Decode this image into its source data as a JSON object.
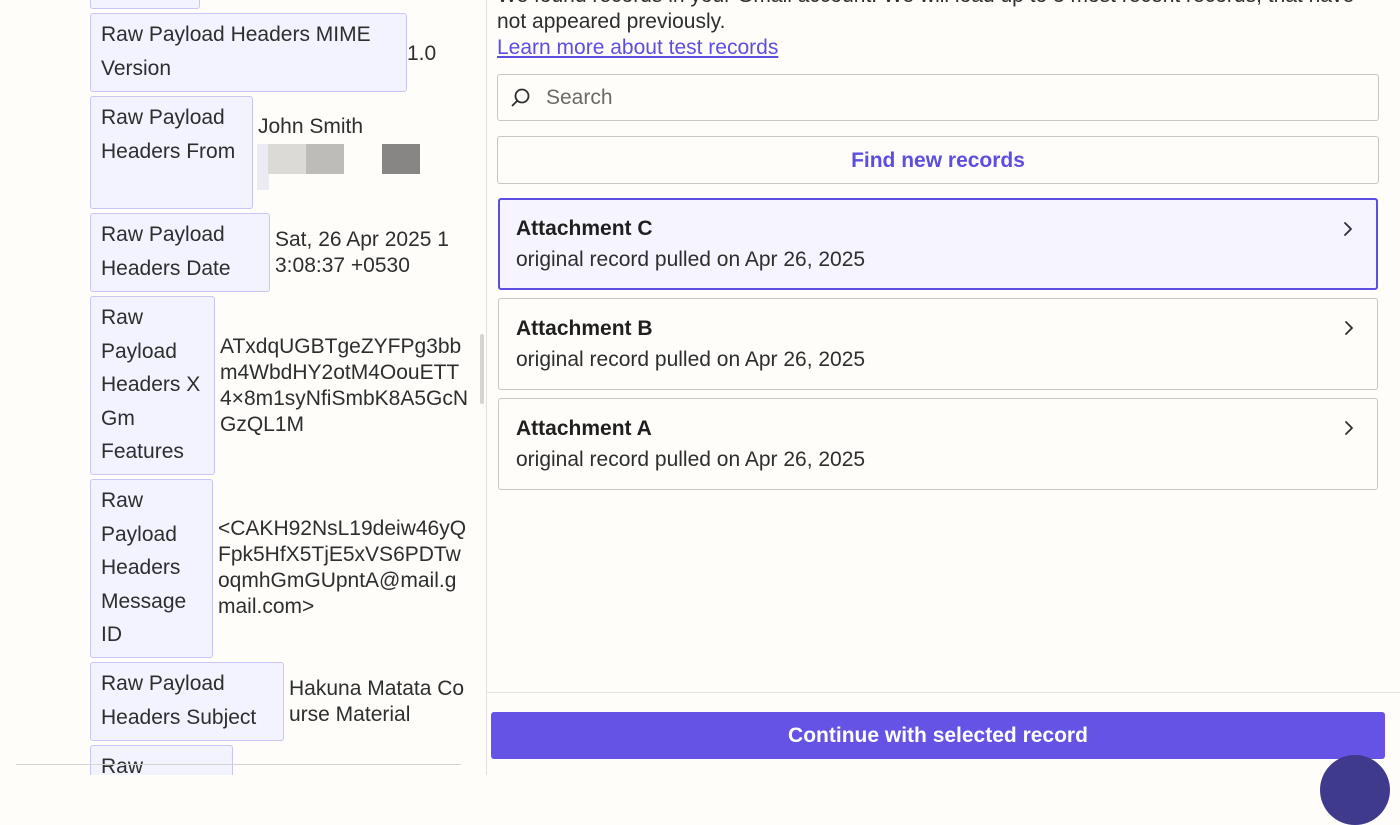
{
  "left_panel": {
    "fields": [
      {
        "key": "Raw Payload Headers MIME Version",
        "value": "1.0"
      },
      {
        "key": "Raw Payload Headers From",
        "value": "John Smith"
      },
      {
        "key": "Raw Payload Headers Date",
        "value": "Sat, 26 Apr 2025 13:08:37 +0530"
      },
      {
        "key": "Raw Payload Headers X Gm Features",
        "value": "ATxdqUGBTgeZYFPg3bbm4WbdHY2otM4OouETT4×8m1syNfiSmbK8A5GcNGzQL1M"
      },
      {
        "key": "Raw Payload Headers Message ID",
        "value": "<CAKH92NsL19deiw46yQFpk5HfX5TjE5xVS6PDTwoqmhGmGUpntA@mail.gmail.com>"
      },
      {
        "key": "Raw Payload Headers Subject",
        "value": "Hakuna Matata Course Material"
      },
      {
        "key": "Raw",
        "value": ""
      }
    ]
  },
  "right_panel": {
    "intro_text": "We found records in your Gmail account. We will load up to 3 most recent records, that have not appeared previously.",
    "learn_more_link": "Learn more about test records",
    "search": {
      "placeholder": "Search",
      "value": ""
    },
    "find_button": "Find new records",
    "records": [
      {
        "title": "Attachment C",
        "subtitle": "original record pulled on Apr 26, 2025",
        "selected": true
      },
      {
        "title": "Attachment B",
        "subtitle": "original record pulled on Apr 26, 2025",
        "selected": false
      },
      {
        "title": "Attachment A",
        "subtitle": "original record pulled on Apr 26, 2025",
        "selected": false
      }
    ],
    "continue_button": "Continue with selected record"
  },
  "colors": {
    "accent": "#6453e4",
    "link": "#5c4ee0",
    "key_chip_bg": "#f3f2ff",
    "key_chip_border": "#c9c6f5",
    "background": "#fffdf9"
  },
  "icons": {
    "search": "search-icon",
    "record_arrow": "chevron-right-icon",
    "help": "help-bubble-icon"
  }
}
